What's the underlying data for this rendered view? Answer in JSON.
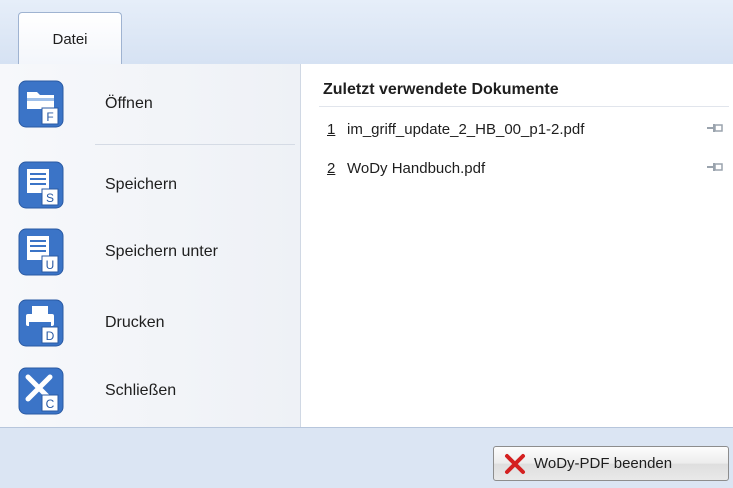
{
  "tabs": {
    "file_tab": "Datei"
  },
  "commands": [
    {
      "label": "Öffnen",
      "badge": "F",
      "icon": "folder-open-icon"
    },
    {
      "label": "Speichern",
      "badge": "S",
      "icon": "save-icon"
    },
    {
      "label": "Speichern unter",
      "badge": "U",
      "icon": "save-as-icon"
    },
    {
      "label": "Drucken",
      "badge": "D",
      "icon": "printer-icon"
    },
    {
      "label": "Schließen",
      "badge": "C",
      "icon": "close-document-icon"
    }
  ],
  "recent": {
    "title": "Zuletzt verwendete Dokumente",
    "items": [
      {
        "num": "1",
        "name": "im_griff_update_2_HB_00_p1-2.pdf"
      },
      {
        "num": "2",
        "name": "WoDy Handbuch.pdf"
      }
    ]
  },
  "footer": {
    "exit_label": "WoDy-PDF beenden"
  },
  "colors": {
    "icon_blue": "#3a73c4",
    "exit_red": "#d42020"
  }
}
